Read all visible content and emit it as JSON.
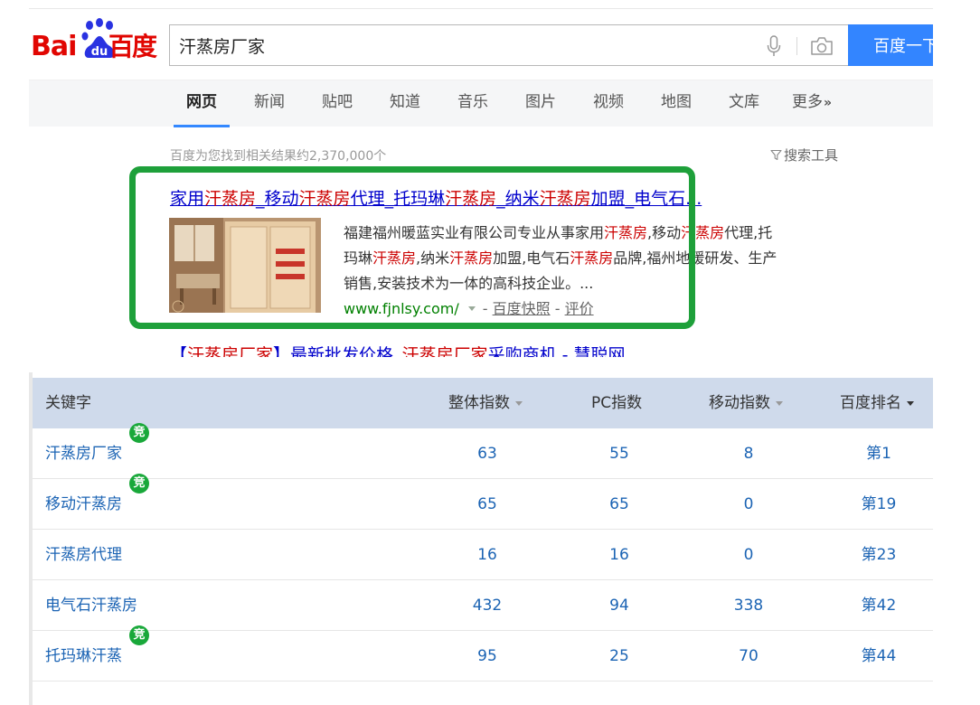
{
  "logo": {
    "part_a": "Bai",
    "part_b": "du",
    "part_c": "百度"
  },
  "search": {
    "query": "汗蒸房厂家",
    "button_label": "百度一下"
  },
  "nav": {
    "tabs": [
      {
        "label": "网页",
        "active": true
      },
      {
        "label": "新闻"
      },
      {
        "label": "贴吧"
      },
      {
        "label": "知道"
      },
      {
        "label": "音乐"
      },
      {
        "label": "图片"
      },
      {
        "label": "视频"
      },
      {
        "label": "地图"
      },
      {
        "label": "文库"
      },
      {
        "label": "更多",
        "suffix": "»"
      }
    ]
  },
  "results_info": {
    "count_text": "百度为您找到相关结果约2,370,000个",
    "tools_label": "搜索工具"
  },
  "result": {
    "title_parts": [
      {
        "t": "家用",
        "hl": false
      },
      {
        "t": "汗蒸房",
        "hl": true
      },
      {
        "t": "_移动",
        "hl": false
      },
      {
        "t": "汗蒸房",
        "hl": true
      },
      {
        "t": "代理_托玛琳",
        "hl": false
      },
      {
        "t": "汗蒸房",
        "hl": true
      },
      {
        "t": "_纳米",
        "hl": false
      },
      {
        "t": "汗蒸房",
        "hl": true
      },
      {
        "t": "加盟_电气石...",
        "hl": false
      }
    ],
    "abstract_lines": [
      [
        {
          "t": "福建福州暖蓝实业有限公司专业从事家用",
          "hl": false
        },
        {
          "t": "汗蒸房",
          "hl": true
        },
        {
          "t": ",移动",
          "hl": false
        },
        {
          "t": "汗蒸房",
          "hl": true
        },
        {
          "t": "代理,托",
          "hl": false
        }
      ],
      [
        {
          "t": "玛琳",
          "hl": false
        },
        {
          "t": "汗蒸房",
          "hl": true
        },
        {
          "t": ",纳米",
          "hl": false
        },
        {
          "t": "汗蒸房",
          "hl": true
        },
        {
          "t": "加盟,电气石",
          "hl": false
        },
        {
          "t": "汗蒸房",
          "hl": true
        },
        {
          "t": "品牌,福州地暖研发、生产",
          "hl": false
        }
      ],
      [
        {
          "t": "销售,安装技术为一体的高科技企业。...",
          "hl": false
        }
      ]
    ],
    "url": "www.fjnlsy.com/",
    "dash": "-",
    "cache_label": "百度快照",
    "review_label": "评价"
  },
  "next_result": {
    "title_parts": [
      {
        "t": "【",
        "hl": false
      },
      {
        "t": "汗蒸房厂家",
        "hl": true
      },
      {
        "t": "】最新批发价格_",
        "hl": false
      },
      {
        "t": "汗蒸房厂家",
        "hl": true
      },
      {
        "t": "采购商机 - 慧聪网",
        "hl": false
      }
    ]
  },
  "table": {
    "headers": {
      "keyword": "关键字",
      "overall": "整体指数",
      "pc": "PC指数",
      "mobile": "移动指数",
      "rank": "百度排名"
    },
    "rows": [
      {
        "keyword": "汗蒸房厂家",
        "jing": true,
        "overall": "63",
        "pc": "55",
        "mobile": "8",
        "rank": "第1"
      },
      {
        "keyword": "移动汗蒸房",
        "jing": true,
        "overall": "65",
        "pc": "65",
        "mobile": "0",
        "rank": "第19"
      },
      {
        "keyword": "汗蒸房代理",
        "jing": false,
        "overall": "16",
        "pc": "16",
        "mobile": "0",
        "rank": "第23"
      },
      {
        "keyword": "电气石汗蒸房",
        "jing": false,
        "overall": "432",
        "pc": "94",
        "mobile": "338",
        "rank": "第42"
      },
      {
        "keyword": "托玛琳汗蒸",
        "jing": true,
        "overall": "95",
        "pc": "25",
        "mobile": "70",
        "rank": "第44"
      }
    ],
    "jing_badge": "竞"
  },
  "colors": {
    "baidu_red": "#e10602",
    "baidu_blue": "#3385ff",
    "link_blue": "#0000cc",
    "highlight_red": "#cc0000",
    "url_green": "#008000",
    "frame_green": "#1ea03a",
    "table_header_bg": "#cfdaeb",
    "table_value_blue": "#1c64b4"
  }
}
